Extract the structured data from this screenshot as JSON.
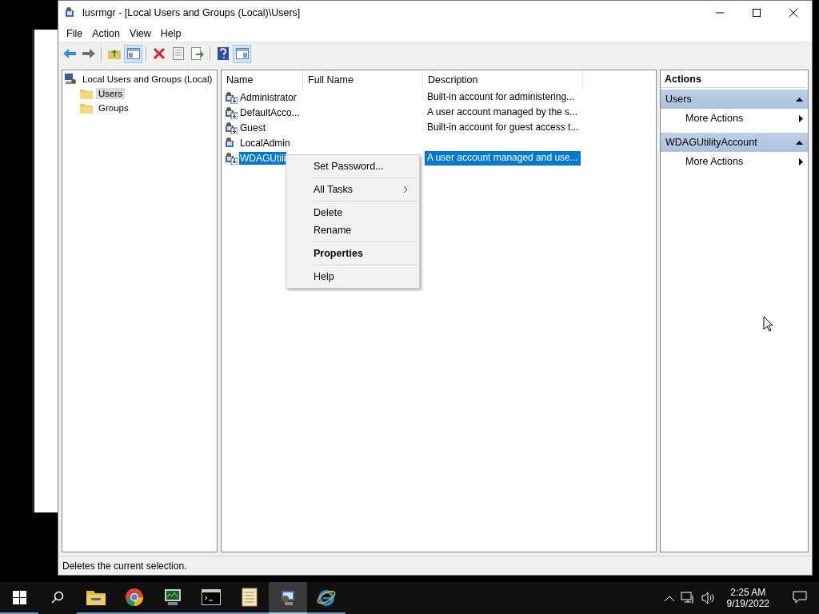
{
  "window": {
    "title": "lusrmgr - [Local Users and Groups (Local)\\Users]"
  },
  "menu": [
    "File",
    "Action",
    "View",
    "Help"
  ],
  "toolbar": [
    {
      "kind": "back",
      "pressed": false
    },
    {
      "kind": "forward",
      "pressed": false
    },
    {
      "kind": "sep"
    },
    {
      "kind": "up",
      "pressed": false
    },
    {
      "kind": "tree",
      "pressed": true
    },
    {
      "kind": "sep"
    },
    {
      "kind": "delete",
      "pressed": false
    },
    {
      "kind": "properties",
      "pressed": false
    },
    {
      "kind": "export",
      "pressed": false
    },
    {
      "kind": "sep"
    },
    {
      "kind": "help",
      "pressed": false
    },
    {
      "kind": "actionpane",
      "pressed": true
    }
  ],
  "tree": {
    "label": "Local Users and Groups (Local)",
    "children": [
      {
        "label": "Users",
        "selected": true
      },
      {
        "label": "Groups",
        "selected": false
      }
    ]
  },
  "list": {
    "columns": [
      "Name",
      "Full Name",
      "Description"
    ],
    "rows": [
      {
        "name": "Administrator",
        "description": "Built-in account for administering...",
        "disabled": true,
        "selected": false
      },
      {
        "name": "DefaultAcco...",
        "description": "A user account managed by the s...",
        "disabled": true,
        "selected": false
      },
      {
        "name": "Guest",
        "description": "Built-in account for guest access t...",
        "disabled": true,
        "selected": false
      },
      {
        "name": "LocalAdmin",
        "disabled": false,
        "selected": false
      },
      {
        "name": "WDAGUtili",
        "description": "A user account managed and use...",
        "disabled": true,
        "selected": true
      }
    ]
  },
  "context_menu": [
    {
      "kind": "item",
      "label": "Set Password...",
      "default": false,
      "submenu": false
    },
    {
      "kind": "sep"
    },
    {
      "kind": "item",
      "label": "All Tasks",
      "default": false,
      "submenu": true
    },
    {
      "kind": "sep"
    },
    {
      "kind": "item",
      "label": "Delete",
      "default": false,
      "submenu": false
    },
    {
      "kind": "item",
      "label": "Rename",
      "default": false,
      "submenu": false
    },
    {
      "kind": "sep"
    },
    {
      "kind": "item",
      "label": "Properties",
      "default": true,
      "submenu": false
    },
    {
      "kind": "sep"
    },
    {
      "kind": "item",
      "label": "Help",
      "default": false,
      "submenu": false
    }
  ],
  "actions": {
    "title": "Actions",
    "sections": [
      {
        "title": "Users",
        "expanded": true,
        "items": [
          "More Actions"
        ]
      },
      {
        "title": "WDAGUtilityAccount",
        "expanded": true,
        "items": [
          "More Actions"
        ]
      }
    ]
  },
  "status_bar": "Deletes the current selection.",
  "taskbar": {
    "apps": [
      {
        "kind": "explorer",
        "active": false
      },
      {
        "kind": "chrome",
        "active": false
      },
      {
        "kind": "monitor",
        "active": false
      },
      {
        "kind": "cmd",
        "active": false
      },
      {
        "kind": "notepad",
        "active": false
      },
      {
        "kind": "lusrmgr",
        "active": true
      },
      {
        "kind": "ie",
        "active": false
      }
    ],
    "time": "2:25 AM",
    "date": "9/19/2022"
  }
}
